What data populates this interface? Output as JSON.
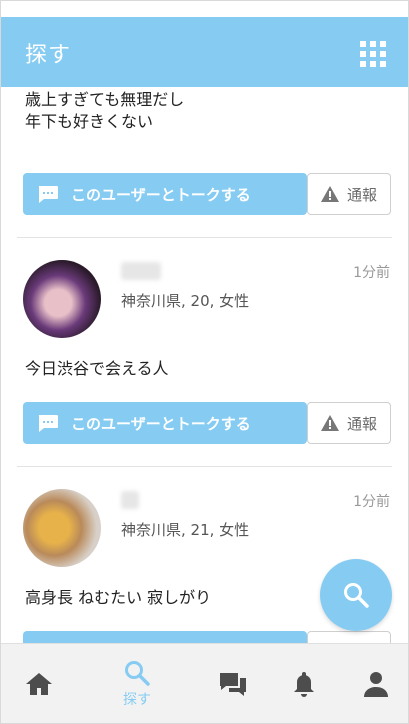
{
  "header": {
    "title": "探す",
    "grid_icon": "grid-icon"
  },
  "feed": {
    "cards": [
      {
        "message": "歳上すぎても無理だし\n年下も好きくない"
      },
      {
        "name": "ちあ",
        "meta": "神奈川県, 20, 女性",
        "time": "1分前",
        "message": "今日渋谷で会える人"
      },
      {
        "name": "",
        "meta": "神奈川県, 21, 女性",
        "time": "1分前",
        "message": "高身長 ねむたい 寂しがり"
      }
    ],
    "talk_label": "このユーザーとトークする",
    "report_label": "通報"
  },
  "tabbar": {
    "items": [
      {
        "icon": "home-icon",
        "label": ""
      },
      {
        "icon": "search-icon",
        "label": "探す"
      },
      {
        "icon": "chat-icon",
        "label": ""
      },
      {
        "icon": "bell-icon",
        "label": ""
      },
      {
        "icon": "person-icon",
        "label": ""
      }
    ]
  },
  "colors": {
    "accent": "#86ccf2",
    "tab_icon": "#4d4d4d"
  }
}
